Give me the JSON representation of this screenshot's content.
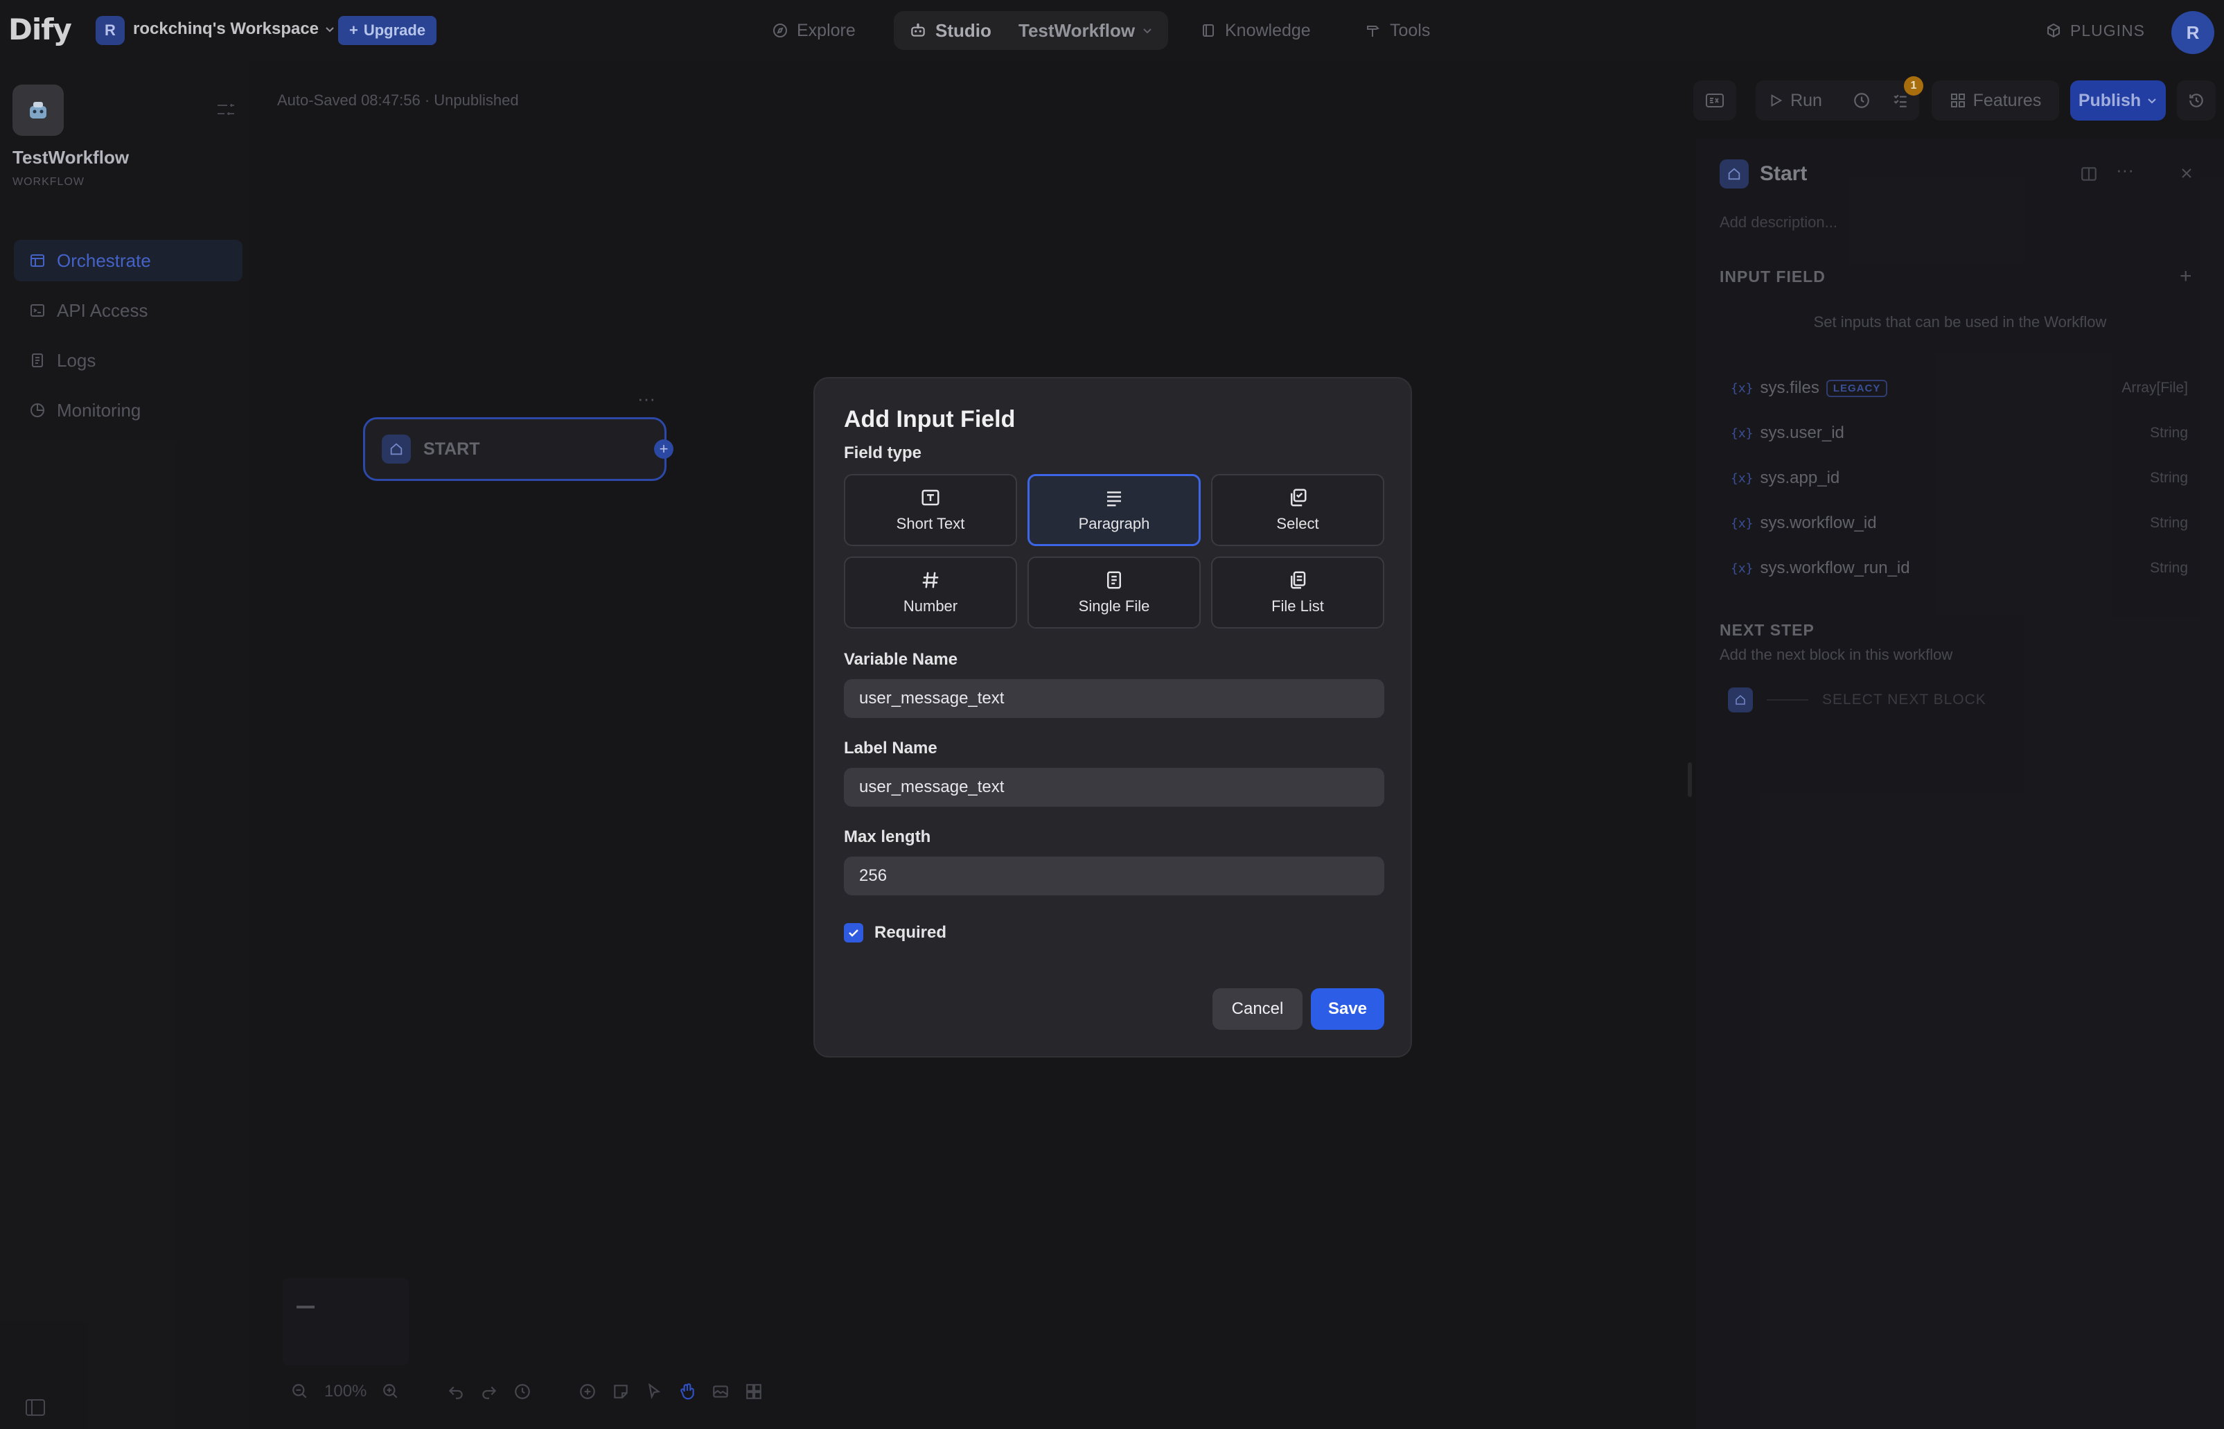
{
  "topbar": {
    "logo": "Dify",
    "workspace_initial": "R",
    "workspace_name": "rockchinq's Workspace",
    "upgrade_label": "Upgrade",
    "nav": {
      "explore": "Explore",
      "studio": "Studio",
      "app_name": "TestWorkflow",
      "knowledge": "Knowledge",
      "tools": "Tools"
    },
    "plugins_label": "PLUGINS",
    "user_initial": "R"
  },
  "sidebar": {
    "app_name": "TestWorkflow",
    "app_type": "WORKFLOW",
    "items": [
      {
        "label": "Orchestrate",
        "active": true
      },
      {
        "label": "API Access"
      },
      {
        "label": "Logs"
      },
      {
        "label": "Monitoring"
      }
    ]
  },
  "canvas": {
    "status": "Auto-Saved 08:47:56 · Unpublished",
    "start_node_label": "START",
    "zoom": "100%"
  },
  "toolbar": {
    "run_label": "Run",
    "checklist_badge": "1",
    "features_label": "Features",
    "publish_label": "Publish"
  },
  "panel": {
    "title": "Start",
    "description_placeholder": "Add description...",
    "input_field_heading": "INPUT FIELD",
    "input_field_hint": "Set inputs that can be used in the Workflow",
    "variables": [
      {
        "name": "sys.files",
        "tag": "LEGACY",
        "type": "Array[File]"
      },
      {
        "name": "sys.user_id",
        "type": "String"
      },
      {
        "name": "sys.app_id",
        "type": "String"
      },
      {
        "name": "sys.workflow_id",
        "type": "String"
      },
      {
        "name": "sys.workflow_run_id",
        "type": "String"
      }
    ],
    "var_marker": "{x}",
    "next_step_heading": "NEXT STEP",
    "next_step_hint": "Add the next block in this workflow",
    "select_next_block": "SELECT NEXT BLOCK"
  },
  "modal": {
    "title": "Add Input Field",
    "field_type_label": "Field type",
    "field_types": [
      {
        "label": "Short Text",
        "icon": "text-input-icon"
      },
      {
        "label": "Paragraph",
        "icon": "paragraph-icon",
        "selected": true
      },
      {
        "label": "Select",
        "icon": "select-icon"
      },
      {
        "label": "Number",
        "icon": "hash-icon"
      },
      {
        "label": "Single File",
        "icon": "file-icon"
      },
      {
        "label": "File List",
        "icon": "file-list-icon"
      }
    ],
    "variable_name_label": "Variable Name",
    "variable_name_value": "user_message_text",
    "label_name_label": "Label Name",
    "label_name_value": "user_message_text",
    "max_length_label": "Max length",
    "max_length_value": "256",
    "required_label": "Required",
    "required_checked": true,
    "cancel_label": "Cancel",
    "save_label": "Save"
  },
  "colors": {
    "accent": "#2b5de6",
    "background": "#18181b",
    "modal_bg": "#27272b"
  }
}
